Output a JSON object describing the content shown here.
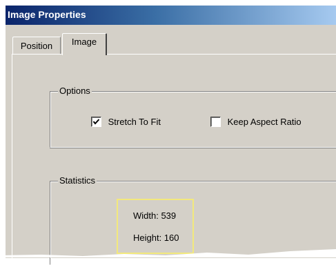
{
  "window": {
    "title": "Image Properties"
  },
  "tabs": [
    {
      "label": "Position",
      "active": false
    },
    {
      "label": "Image",
      "active": true
    }
  ],
  "options": {
    "legend": "Options",
    "stretch_to_fit": {
      "label": "Stretch To Fit",
      "checked": true
    },
    "keep_aspect_ratio": {
      "label": "Keep Aspect Ratio",
      "checked": false
    }
  },
  "statistics": {
    "legend": "Statistics",
    "width_text": "Width: 539",
    "height_text": "Height: 160"
  },
  "colors": {
    "titlebar_start": "#0a246a",
    "titlebar_end": "#a6caf0",
    "dialog_face": "#d4d0c8",
    "highlight_border": "#f3e97c"
  },
  "icons": {
    "checkmark": "check-icon"
  }
}
